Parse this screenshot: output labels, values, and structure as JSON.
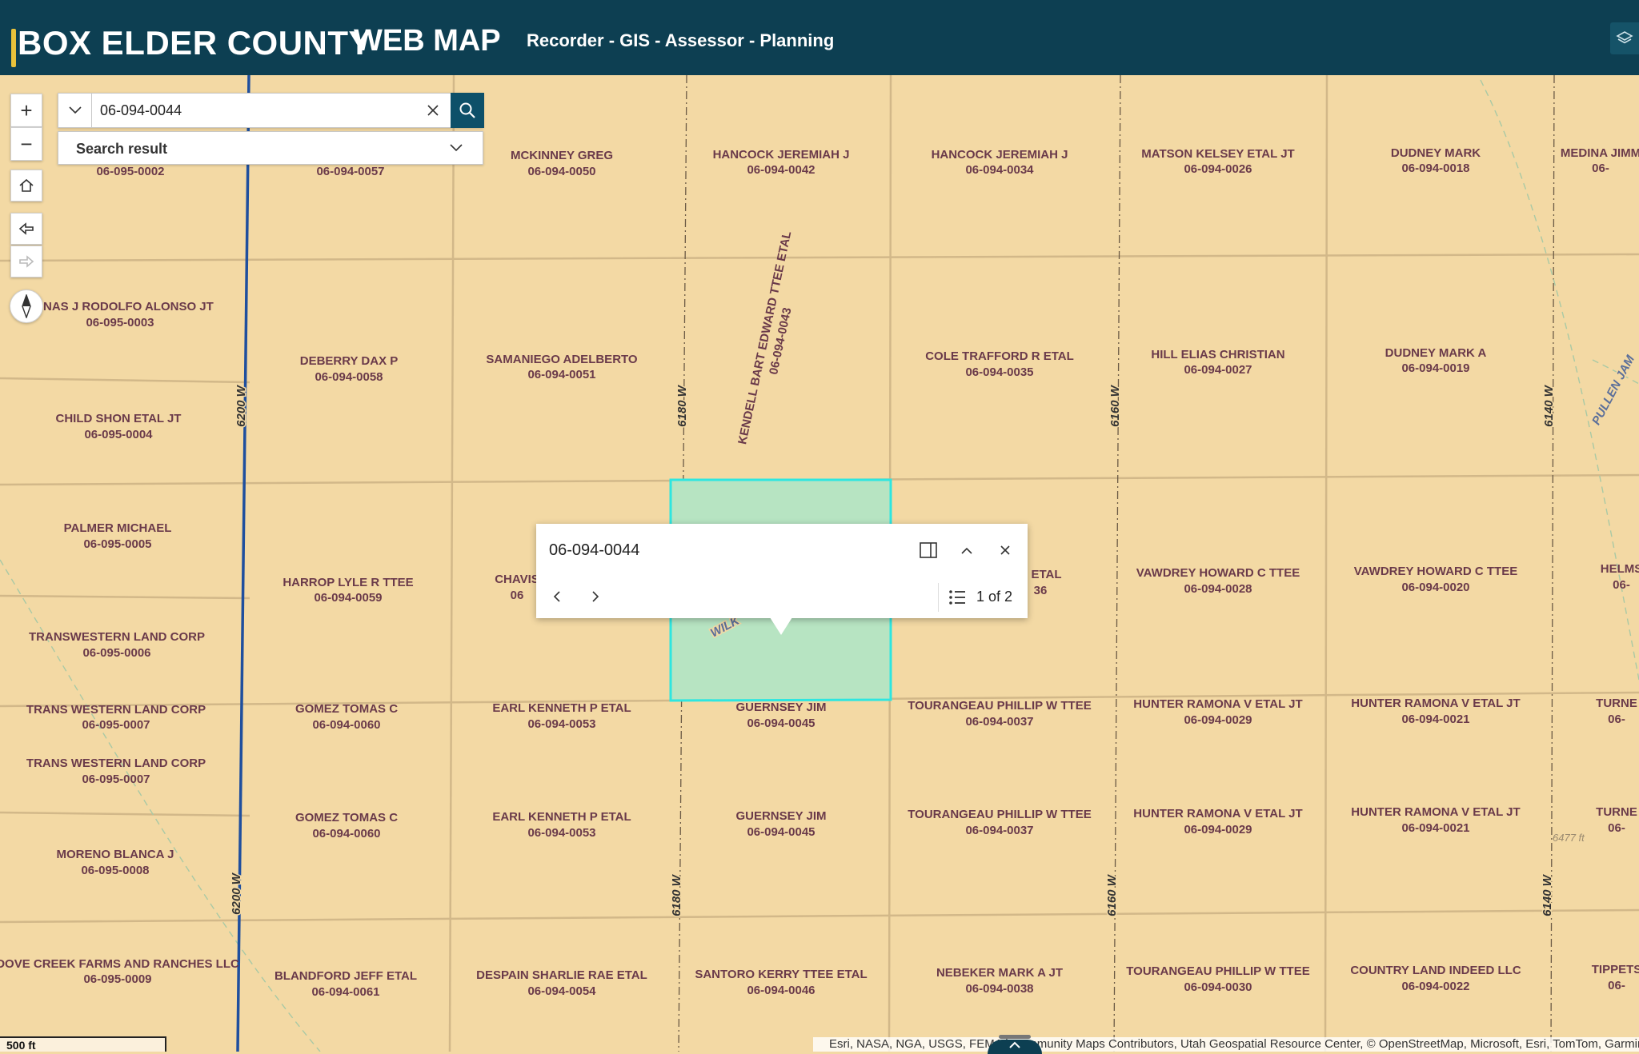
{
  "header": {
    "title_part1": "BOX ELDER COUNTY",
    "title_part2": "WEB MAP",
    "subtitle": "Recorder - GIS - Assessor - Planning"
  },
  "search": {
    "value": "06-094-0044",
    "result_label": "Search result"
  },
  "popup": {
    "title": "06-094-0044",
    "page_indicator": "1 of 2"
  },
  "colors": {
    "header_bg": "#0d3f52",
    "map_bg": "#f3d9a4",
    "parcel_line": "#d2b889",
    "road_main": "#1f4f9e",
    "selected_fill": "#b7e4c2",
    "selected_outline": "#2ee6e0",
    "label_color": "#6a3a4a",
    "accent": "#e9c23b"
  },
  "icons": {
    "zoom_in": "plus-icon",
    "zoom_out": "minus-icon",
    "home": "home-icon",
    "back": "arrow-left-icon",
    "forward": "arrow-right-icon",
    "compass": "compass-icon",
    "layers": "layers-icon",
    "search": "search-icon",
    "clear": "close-icon",
    "dock": "dock-icon"
  },
  "scalebar": {
    "label": "500 ft"
  },
  "attribution": "Esri, NASA, NGA, USGS, FEMA | Community Maps Contributors, Utah Geospatial Resource Center, © OpenStreetMap, Microsoft, Esri, TomTom, Garmin, SafeGraph, GeoTechnologies, Inc, METI/NASA, USGS, EPA, NPS, US Census Bureau, USDA",
  "roads": [
    {
      "name": "6200 W"
    },
    {
      "name": "6200 W"
    },
    {
      "name": "6180 W"
    },
    {
      "name": "6180 W"
    },
    {
      "name": "6160 W"
    },
    {
      "name": "6160 W"
    },
    {
      "name": "6140 W"
    },
    {
      "name": "6140 W"
    },
    {
      "name": "WILK"
    },
    {
      "name": "PULLEN JAM"
    }
  ],
  "elevation_note": "6477 ft",
  "parcels": [
    {
      "owner": "",
      "id": "06-095-0002"
    },
    {
      "owner": "",
      "id": "06-094-0057"
    },
    {
      "owner": "MCKINNEY GREG",
      "id": "06-094-0050"
    },
    {
      "owner": "HANCOCK JEREMIAH J",
      "id": "06-094-0042"
    },
    {
      "owner": "HANCOCK JEREMIAH J",
      "id": "06-094-0034"
    },
    {
      "owner": "MATSON KELSEY ETAL JT",
      "id": "06-094-0026"
    },
    {
      "owner": "DUDNEY MARK",
      "id": "06-094-0018"
    },
    {
      "owner": "MEDINA JIMM",
      "id": "06-"
    },
    {
      "owner": "DENAS J RODOLFO ALONSO JT",
      "id": "06-095-0003"
    },
    {
      "owner": "DEBERRY DAX P",
      "id": "06-094-0058"
    },
    {
      "owner": "SAMANIEGO ADELBERTO",
      "id": "06-094-0051"
    },
    {
      "owner": "KENDELL BART EDWARD TTEE ETAL",
      "id": "06-094-0043"
    },
    {
      "owner": "COLE TRAFFORD R ETAL",
      "id": "06-094-0035"
    },
    {
      "owner": "HILL ELIAS CHRISTIAN",
      "id": "06-094-0027"
    },
    {
      "owner": "DUDNEY MARK A",
      "id": "06-094-0019"
    },
    {
      "owner": "CHILD SHON ETAL JT",
      "id": "06-095-0004"
    },
    {
      "owner": "PALMER MICHAEL",
      "id": "06-095-0005"
    },
    {
      "owner": "HARROP LYLE R TTEE",
      "id": "06-094-0059"
    },
    {
      "owner": "CHAVIS",
      "id": "06"
    },
    {
      "owner": "R ETAL",
      "id": "36"
    },
    {
      "owner": "VAWDREY HOWARD C TTEE",
      "id": "06-094-0028"
    },
    {
      "owner": "VAWDREY HOWARD C TTEE",
      "id": "06-094-0020"
    },
    {
      "owner": "HELMS",
      "id": "06-"
    },
    {
      "owner": "TRANSWESTERN LAND CORP",
      "id": "06-095-0006"
    },
    {
      "owner": "TRANS WESTERN LAND CORP",
      "id": "06-095-0007"
    },
    {
      "owner": "GOMEZ TOMAS C",
      "id": "06-094-0060"
    },
    {
      "owner": "EARL KENNETH P ETAL",
      "id": "06-094-0053"
    },
    {
      "owner": "GUERNSEY JIM",
      "id": "06-094-0045"
    },
    {
      "owner": "TOURANGEAU PHILLIP W TTEE",
      "id": "06-094-0037"
    },
    {
      "owner": "HUNTER RAMONA V ETAL JT",
      "id": "06-094-0029"
    },
    {
      "owner": "HUNTER RAMONA V ETAL JT",
      "id": "06-094-0021"
    },
    {
      "owner": "TURNE",
      "id": "06-"
    },
    {
      "owner": "TRANS WESTERN LAND CORP",
      "id": "06-095-0007"
    },
    {
      "owner": "GOMEZ TOMAS C",
      "id": "06-094-0060"
    },
    {
      "owner": "EARL KENNETH P ETAL",
      "id": "06-094-0053"
    },
    {
      "owner": "GUERNSEY JIM",
      "id": "06-094-0045"
    },
    {
      "owner": "TOURANGEAU PHILLIP W TTEE",
      "id": "06-094-0037"
    },
    {
      "owner": "HUNTER RAMONA V ETAL JT",
      "id": "06-094-0029"
    },
    {
      "owner": "HUNTER RAMONA V ETAL JT",
      "id": "06-094-0021"
    },
    {
      "owner": "TURNE",
      "id": "06-"
    },
    {
      "owner": "MORENO BLANCA J",
      "id": "06-095-0008"
    },
    {
      "owner": "DOVE CREEK FARMS AND RANCHES LLC",
      "id": "06-095-0009"
    },
    {
      "owner": "BLANDFORD JEFF ETAL",
      "id": "06-094-0061"
    },
    {
      "owner": "DESPAIN SHARLIE RAE ETAL",
      "id": "06-094-0054"
    },
    {
      "owner": "SANTORO KERRY TTEE ETAL",
      "id": "06-094-0046"
    },
    {
      "owner": "NEBEKER MARK A JT",
      "id": "06-094-0038"
    },
    {
      "owner": "TOURANGEAU PHILLIP W TTEE",
      "id": "06-094-0030"
    },
    {
      "owner": "COUNTRY LAND INDEED LLC",
      "id": "06-094-0022"
    },
    {
      "owner": "TIPPETS",
      "id": "06-"
    }
  ]
}
